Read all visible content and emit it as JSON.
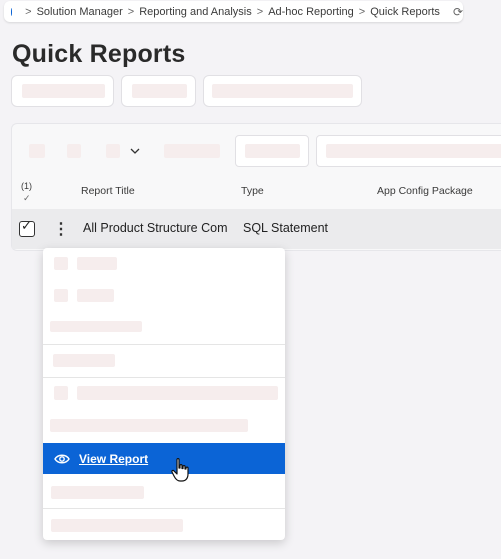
{
  "breadcrumb": {
    "items": [
      "Solution Manager",
      "Reporting and Analysis",
      "Ad-hoc Reporting",
      "Quick Reports"
    ],
    "separator": ">"
  },
  "page": {
    "title": "Quick Reports"
  },
  "table": {
    "selection_count": "(1)",
    "selection_check": "✓",
    "columns": [
      "Report Title",
      "Type",
      "App Config Package"
    ],
    "rows": [
      {
        "report_title": "All Product Structure Com",
        "type": "SQL Statement",
        "app_config_package": ""
      }
    ]
  },
  "context_menu": {
    "active_item": {
      "label": "View Report",
      "icon": "eye-icon"
    }
  },
  "colors": {
    "accent": "#0b64d6",
    "background": "#f4f3f6"
  }
}
